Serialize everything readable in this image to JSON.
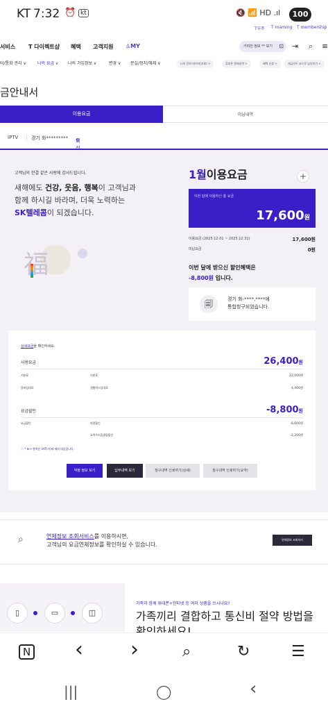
{
  "status_bar": {
    "time": "7:32",
    "carrier": "KT",
    "alarm_icon": "alarm-icon",
    "kt_badge": "kt",
    "icons": "🔇 📶 HD .ıl",
    "battery": "100"
  },
  "top_links": [
    "T우주",
    "T roaming",
    "T membership"
  ],
  "gnb": {
    "items": [
      "서비스",
      "T 다이렉트샵",
      "혜택",
      "고객지원"
    ],
    "my": "MY",
    "pill_text": "가려진 정보 ** 보기"
  },
  "subnav": {
    "items": [
      "터/통화 관리 ∨",
      "나의 요금 ∨",
      "나의 가입정보 ∨",
      "변경 ∨",
      "분실/정지/해제 ∨"
    ],
    "chips": [
      "나의 잔여 데이터(조회) >",
      "휴대폰 결제내역 >",
      "혜택 신청 >",
      "세금모두 코드로 납부하기 >"
    ]
  },
  "page_title": "금안내서",
  "tabs": {
    "active": "이용요금",
    "inactive": "미납내역"
  },
  "line_info": {
    "product": "IPTV",
    "sep": "|",
    "address": "경기 화*********",
    "change_label": "회선변경"
  },
  "greeting": {
    "small": "고객님의 한결 같은 사랑에 감사드립니다.",
    "line1_pre": "새해에도 ",
    "line1_bold": "건강, 웃음, 행복",
    "line1_post": "이 고객님과",
    "line2": "함께 하시길 바라며, 더욱 노력하는",
    "line3_brand": "SK텔레콤",
    "line3_post": "이 되겠습니다.",
    "fortune_char": "福"
  },
  "bill": {
    "month": "1월",
    "title": "이용요금",
    "plus": "+",
    "total_label": "이번 달에 이용하신 총 요금",
    "total_amount": "17,600",
    "won": "원",
    "usage_label": "이용요금 (2025.12.01 ~ 2025.12.31)",
    "usage_value": "17,600원",
    "unpaid_label": "미납요금",
    "unpaid_value": "0원",
    "discount_line1": "이번 달에 받으신 할인혜택은",
    "discount_amount": "-8,800원",
    "discount_line2_post": " 입니다.",
    "merge_line1": "경기 화-****,****에",
    "merge_line2": "통합청구되었습니다."
  },
  "detail": {
    "hint_link": "상세요금",
    "hint_post": "을 확인하세요.",
    "usage_title": "사용요금",
    "usage_amount": "26,400",
    "rows1": [
      {
        "c1": "기본료",
        "c2": "기본료",
        "c3": "22,000원"
      },
      {
        "c1": "장비임대료",
        "c2": "셋톱박스임대료",
        "c3": "4,400원"
      }
    ],
    "discount_title": "요금할인",
    "discount_amount": "-8,800",
    "rows2": [
      {
        "c1": "요금할인",
        "c2": "약정할인",
        "c3": "-6,600원"
      },
      {
        "c1": "",
        "c2": "요족우리집결합할인",
        "c3": "-2,200원"
      }
    ],
    "note": "* 표시 항목은 VAT(가)세 제외 대상입니다.",
    "buttons": [
      "약정 정보 보기",
      "납부내역 보기",
      "청구내역 인쇄하기(상세)",
      "청구내역 인쇄하기(요약)"
    ]
  },
  "overdue": {
    "link": "연체정보 조회서비스",
    "line1_post": "를 이용하시면,",
    "line2": "고객님의 요금연체정보를 확인하실 수 있습니다.",
    "button": "연체정보 조회하기"
  },
  "promo": {
    "small": "가족과 함께 휴대폰+인터넷 등 여러 상품을 쓰시나요?",
    "big": "가족끼리 결합하고 통신비 절약 방법을 확인하세요!"
  },
  "browser": {
    "icons": [
      "N",
      "‹",
      "›",
      "⌕",
      "↻",
      "☰"
    ]
  },
  "sysnav": {
    "icons": [
      "|||",
      "◯",
      "‹"
    ]
  }
}
